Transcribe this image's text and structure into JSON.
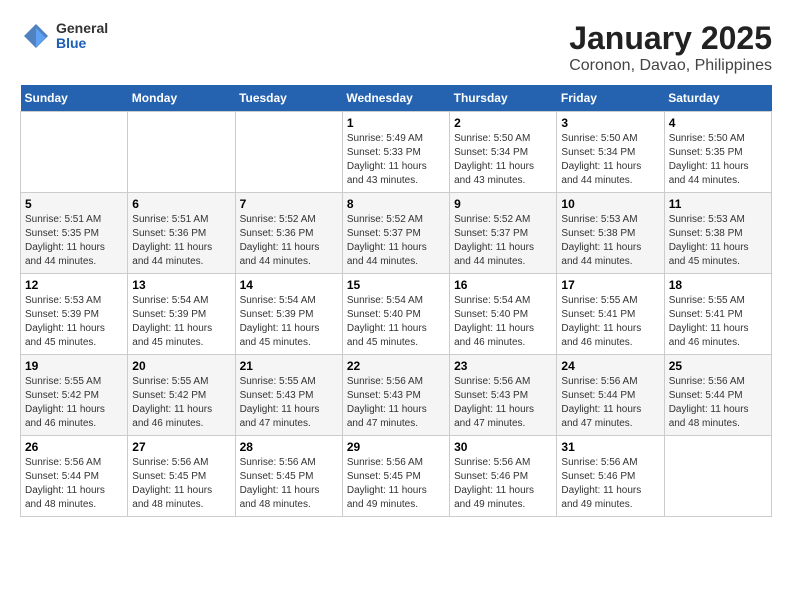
{
  "logo": {
    "general": "General",
    "blue": "Blue"
  },
  "title": "January 2025",
  "subtitle": "Coronon, Davao, Philippines",
  "days_of_week": [
    "Sunday",
    "Monday",
    "Tuesday",
    "Wednesday",
    "Thursday",
    "Friday",
    "Saturday"
  ],
  "weeks": [
    [
      {
        "day": "",
        "info": ""
      },
      {
        "day": "",
        "info": ""
      },
      {
        "day": "",
        "info": ""
      },
      {
        "day": "1",
        "sunrise": "Sunrise: 5:49 AM",
        "sunset": "Sunset: 5:33 PM",
        "daylight": "Daylight: 11 hours and 43 minutes."
      },
      {
        "day": "2",
        "sunrise": "Sunrise: 5:50 AM",
        "sunset": "Sunset: 5:34 PM",
        "daylight": "Daylight: 11 hours and 43 minutes."
      },
      {
        "day": "3",
        "sunrise": "Sunrise: 5:50 AM",
        "sunset": "Sunset: 5:34 PM",
        "daylight": "Daylight: 11 hours and 44 minutes."
      },
      {
        "day": "4",
        "sunrise": "Sunrise: 5:50 AM",
        "sunset": "Sunset: 5:35 PM",
        "daylight": "Daylight: 11 hours and 44 minutes."
      }
    ],
    [
      {
        "day": "5",
        "sunrise": "Sunrise: 5:51 AM",
        "sunset": "Sunset: 5:35 PM",
        "daylight": "Daylight: 11 hours and 44 minutes."
      },
      {
        "day": "6",
        "sunrise": "Sunrise: 5:51 AM",
        "sunset": "Sunset: 5:36 PM",
        "daylight": "Daylight: 11 hours and 44 minutes."
      },
      {
        "day": "7",
        "sunrise": "Sunrise: 5:52 AM",
        "sunset": "Sunset: 5:36 PM",
        "daylight": "Daylight: 11 hours and 44 minutes."
      },
      {
        "day": "8",
        "sunrise": "Sunrise: 5:52 AM",
        "sunset": "Sunset: 5:37 PM",
        "daylight": "Daylight: 11 hours and 44 minutes."
      },
      {
        "day": "9",
        "sunrise": "Sunrise: 5:52 AM",
        "sunset": "Sunset: 5:37 PM",
        "daylight": "Daylight: 11 hours and 44 minutes."
      },
      {
        "day": "10",
        "sunrise": "Sunrise: 5:53 AM",
        "sunset": "Sunset: 5:38 PM",
        "daylight": "Daylight: 11 hours and 44 minutes."
      },
      {
        "day": "11",
        "sunrise": "Sunrise: 5:53 AM",
        "sunset": "Sunset: 5:38 PM",
        "daylight": "Daylight: 11 hours and 45 minutes."
      }
    ],
    [
      {
        "day": "12",
        "sunrise": "Sunrise: 5:53 AM",
        "sunset": "Sunset: 5:39 PM",
        "daylight": "Daylight: 11 hours and 45 minutes."
      },
      {
        "day": "13",
        "sunrise": "Sunrise: 5:54 AM",
        "sunset": "Sunset: 5:39 PM",
        "daylight": "Daylight: 11 hours and 45 minutes."
      },
      {
        "day": "14",
        "sunrise": "Sunrise: 5:54 AM",
        "sunset": "Sunset: 5:39 PM",
        "daylight": "Daylight: 11 hours and 45 minutes."
      },
      {
        "day": "15",
        "sunrise": "Sunrise: 5:54 AM",
        "sunset": "Sunset: 5:40 PM",
        "daylight": "Daylight: 11 hours and 45 minutes."
      },
      {
        "day": "16",
        "sunrise": "Sunrise: 5:54 AM",
        "sunset": "Sunset: 5:40 PM",
        "daylight": "Daylight: 11 hours and 46 minutes."
      },
      {
        "day": "17",
        "sunrise": "Sunrise: 5:55 AM",
        "sunset": "Sunset: 5:41 PM",
        "daylight": "Daylight: 11 hours and 46 minutes."
      },
      {
        "day": "18",
        "sunrise": "Sunrise: 5:55 AM",
        "sunset": "Sunset: 5:41 PM",
        "daylight": "Daylight: 11 hours and 46 minutes."
      }
    ],
    [
      {
        "day": "19",
        "sunrise": "Sunrise: 5:55 AM",
        "sunset": "Sunset: 5:42 PM",
        "daylight": "Daylight: 11 hours and 46 minutes."
      },
      {
        "day": "20",
        "sunrise": "Sunrise: 5:55 AM",
        "sunset": "Sunset: 5:42 PM",
        "daylight": "Daylight: 11 hours and 46 minutes."
      },
      {
        "day": "21",
        "sunrise": "Sunrise: 5:55 AM",
        "sunset": "Sunset: 5:43 PM",
        "daylight": "Daylight: 11 hours and 47 minutes."
      },
      {
        "day": "22",
        "sunrise": "Sunrise: 5:56 AM",
        "sunset": "Sunset: 5:43 PM",
        "daylight": "Daylight: 11 hours and 47 minutes."
      },
      {
        "day": "23",
        "sunrise": "Sunrise: 5:56 AM",
        "sunset": "Sunset: 5:43 PM",
        "daylight": "Daylight: 11 hours and 47 minutes."
      },
      {
        "day": "24",
        "sunrise": "Sunrise: 5:56 AM",
        "sunset": "Sunset: 5:44 PM",
        "daylight": "Daylight: 11 hours and 47 minutes."
      },
      {
        "day": "25",
        "sunrise": "Sunrise: 5:56 AM",
        "sunset": "Sunset: 5:44 PM",
        "daylight": "Daylight: 11 hours and 48 minutes."
      }
    ],
    [
      {
        "day": "26",
        "sunrise": "Sunrise: 5:56 AM",
        "sunset": "Sunset: 5:44 PM",
        "daylight": "Daylight: 11 hours and 48 minutes."
      },
      {
        "day": "27",
        "sunrise": "Sunrise: 5:56 AM",
        "sunset": "Sunset: 5:45 PM",
        "daylight": "Daylight: 11 hours and 48 minutes."
      },
      {
        "day": "28",
        "sunrise": "Sunrise: 5:56 AM",
        "sunset": "Sunset: 5:45 PM",
        "daylight": "Daylight: 11 hours and 48 minutes."
      },
      {
        "day": "29",
        "sunrise": "Sunrise: 5:56 AM",
        "sunset": "Sunset: 5:45 PM",
        "daylight": "Daylight: 11 hours and 49 minutes."
      },
      {
        "day": "30",
        "sunrise": "Sunrise: 5:56 AM",
        "sunset": "Sunset: 5:46 PM",
        "daylight": "Daylight: 11 hours and 49 minutes."
      },
      {
        "day": "31",
        "sunrise": "Sunrise: 5:56 AM",
        "sunset": "Sunset: 5:46 PM",
        "daylight": "Daylight: 11 hours and 49 minutes."
      },
      {
        "day": "",
        "info": ""
      }
    ]
  ]
}
